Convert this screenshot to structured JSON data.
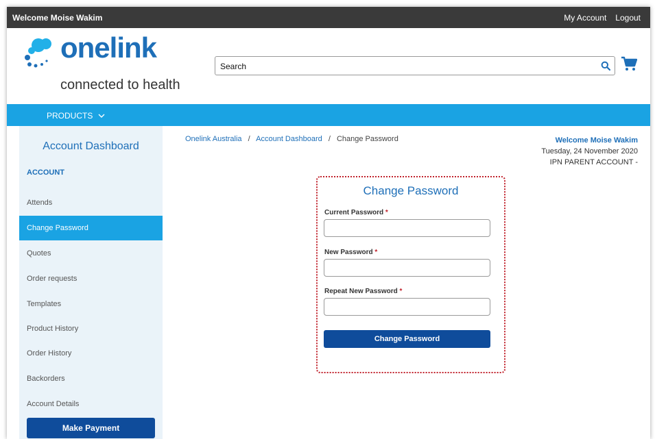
{
  "topbar": {
    "welcome": "Welcome Moise Wakim",
    "my_account": "My Account",
    "logout": "Logout"
  },
  "logo": {
    "word": "onelink",
    "tagline": "connected to health"
  },
  "search": {
    "placeholder": "Search"
  },
  "nav": {
    "products": "PRODUCTS"
  },
  "sidebar": {
    "title": "Account Dashboard",
    "section": "ACCOUNT",
    "items": [
      {
        "label": "Attends"
      },
      {
        "label": "Change Password"
      },
      {
        "label": "Quotes"
      },
      {
        "label": "Order requests"
      },
      {
        "label": "Templates"
      },
      {
        "label": "Product History"
      },
      {
        "label": "Order History"
      },
      {
        "label": "Backorders"
      },
      {
        "label": "Account Details"
      }
    ],
    "payment_button": "Make Payment"
  },
  "breadcrumb": {
    "home": "Onelink Australia",
    "dashboard": "Account Dashboard",
    "current": "Change Password",
    "separator": "/"
  },
  "account_info": {
    "name": "Welcome Moise Wakim",
    "date": "Tuesday, 24 November 2020",
    "account": "IPN PARENT ACCOUNT -"
  },
  "form": {
    "title": "Change Password",
    "current_label": "Current Password",
    "new_label": "New Password",
    "repeat_label": "Repeat New Password",
    "required_mark": "*",
    "submit": "Change Password"
  },
  "colors": {
    "primary_blue": "#1e6fb8",
    "nav_blue": "#1aa3e3",
    "button_blue": "#0f4c9b",
    "required_red": "#c0202a"
  }
}
